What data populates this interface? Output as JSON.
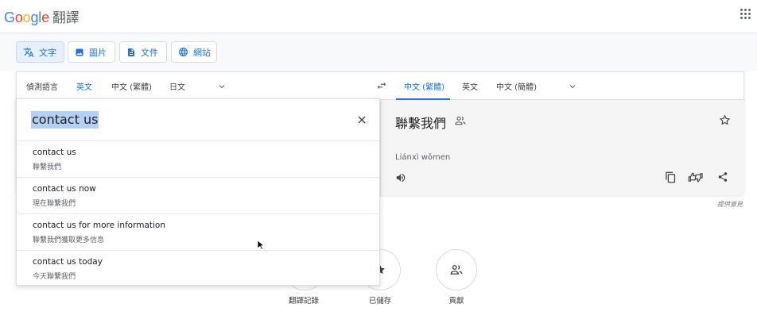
{
  "header": {
    "brand": "Google",
    "product": "翻譯"
  },
  "modes": [
    {
      "label": "文字",
      "icon": "translate-icon",
      "active": true
    },
    {
      "label": "圖片",
      "icon": "image-icon"
    },
    {
      "label": "文件",
      "icon": "document-icon"
    },
    {
      "label": "網站",
      "icon": "globe-icon"
    }
  ],
  "source_langs": [
    "偵測語言",
    "英文",
    "中文 (繁體)",
    "日文"
  ],
  "target_langs": [
    "中文 (繁體)",
    "英文",
    "中文 (簡體)"
  ],
  "input": {
    "text": "contact us"
  },
  "output": {
    "text": "聯繫我們",
    "romanization": "Liánxì wǒmen"
  },
  "suggestions": [
    {
      "en": "contact us",
      "zh": "聯繫我們"
    },
    {
      "en": "contact us now",
      "zh": "現在聯繫我們"
    },
    {
      "en": "contact us for more information",
      "zh": "聯繫我們獲取更多信息"
    },
    {
      "en": "contact us today",
      "zh": "今天聯繫我們"
    }
  ],
  "feedback": "提供意見",
  "bottom": [
    {
      "label": "翻譯記錄"
    },
    {
      "label": "已儲存"
    },
    {
      "label": "貢獻"
    }
  ],
  "colors": {
    "accent": "#1a73e8",
    "selection": "#b4d1f3"
  }
}
